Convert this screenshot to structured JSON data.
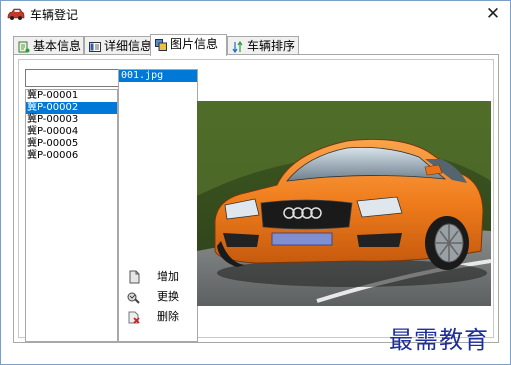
{
  "window": {
    "title": "车辆登记",
    "close_label": "✕"
  },
  "tabs": [
    {
      "label": "基本信息",
      "icon": "basic-info-icon"
    },
    {
      "label": "详细信息",
      "icon": "detail-info-icon"
    },
    {
      "label": "图片信息",
      "icon": "picture-info-icon"
    },
    {
      "label": "车辆排序",
      "icon": "sort-icon"
    }
  ],
  "active_tab": "图片信息",
  "search": {
    "value": ""
  },
  "plates": [
    "冀P-00001",
    "冀P-00002",
    "冀P-00003",
    "冀P-00004",
    "冀P-00005",
    "冀P-00006"
  ],
  "selected_plate": "冀P-00002",
  "files": [
    "001.jpg"
  ],
  "selected_file": "001.jpg",
  "actions": {
    "add": "增加",
    "replace": "更换",
    "delete": "删除"
  },
  "watermark": "最需教育",
  "colors": {
    "selection": "#0078d7",
    "car": "#f0801e",
    "watermark": "#1f2f9a"
  }
}
